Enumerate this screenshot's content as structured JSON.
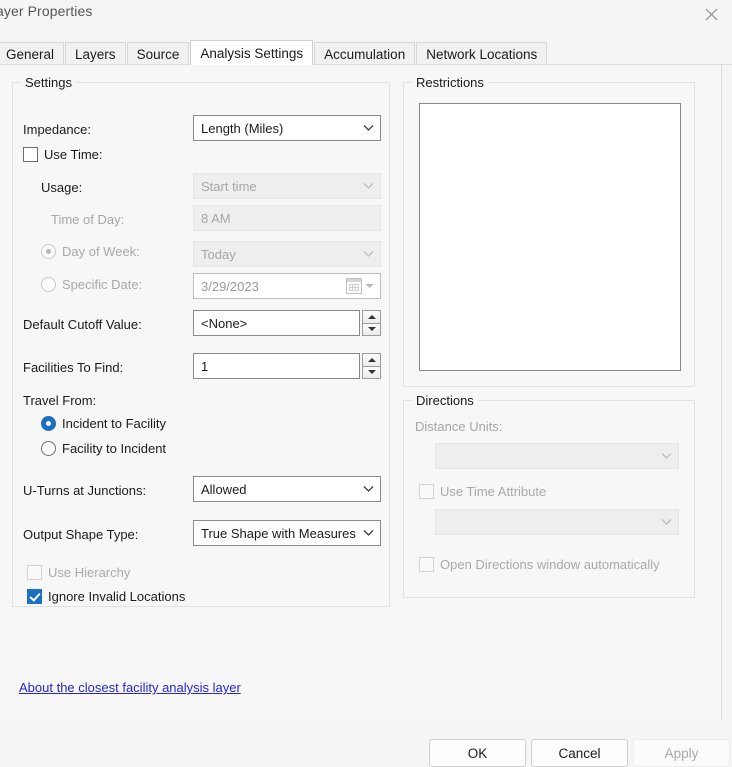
{
  "window": {
    "title": "ayer Properties",
    "close_icon": "close-icon"
  },
  "tabs": [
    {
      "label": "General",
      "active": false
    },
    {
      "label": "Layers",
      "active": false
    },
    {
      "label": "Source",
      "active": false
    },
    {
      "label": "Analysis Settings",
      "active": true
    },
    {
      "label": "Accumulation",
      "active": false
    },
    {
      "label": "Network Locations",
      "active": false
    }
  ],
  "settings": {
    "group_title": "Settings",
    "impedance": {
      "label": "Impedance:",
      "value": "Length (Miles)",
      "enabled": true
    },
    "use_time": {
      "label": "Use Time:",
      "checked": false
    },
    "usage": {
      "label": "Usage:",
      "value": "Start time",
      "enabled": false
    },
    "time_of_day": {
      "label": "Time of Day:",
      "value": "8 AM",
      "enabled": false
    },
    "day_of_week": {
      "label": "Day of Week:",
      "value": "Today",
      "selected": true,
      "enabled": false
    },
    "specific_date": {
      "label": "Specific Date:",
      "value": "3/29/2023",
      "selected": false,
      "enabled": false
    },
    "default_cutoff": {
      "label": "Default Cutoff Value:",
      "value": "<None>"
    },
    "facilities_to_find": {
      "label": "Facilities To Find:",
      "value": "1"
    },
    "travel_from": {
      "label": "Travel From:",
      "options": [
        {
          "label": "Incident to Facility",
          "selected": true
        },
        {
          "label": "Facility to Incident",
          "selected": false
        }
      ]
    },
    "u_turns": {
      "label": "U-Turns at Junctions:",
      "value": "Allowed"
    },
    "output_shape_type": {
      "label": "Output Shape Type:",
      "value": "True Shape with Measures"
    },
    "use_hierarchy": {
      "label": "Use Hierarchy",
      "checked": false,
      "enabled": false
    },
    "ignore_invalid_locations": {
      "label": "Ignore Invalid Locations",
      "checked": true,
      "enabled": true
    }
  },
  "restrictions": {
    "group_title": "Restrictions",
    "items": []
  },
  "directions": {
    "group_title": "Directions",
    "distance_units": {
      "label": "Distance Units:",
      "value": "",
      "enabled": false
    },
    "use_time_attribute": {
      "label": "Use Time Attribute",
      "checked": false,
      "enabled": false
    },
    "time_attribute": {
      "value": "",
      "enabled": false
    },
    "open_directions_window": {
      "label": "Open Directions window automatically",
      "checked": false,
      "enabled": false
    }
  },
  "help_link": {
    "label": "About the closest facility analysis layer"
  },
  "footer": {
    "ok": "OK",
    "cancel": "Cancel",
    "apply": "Apply"
  },
  "colors": {
    "accent": "#1d6fc0",
    "link": "#2526d6",
    "panel_bg": "#f7f7f7",
    "window_bg": "#f5f5f5"
  }
}
